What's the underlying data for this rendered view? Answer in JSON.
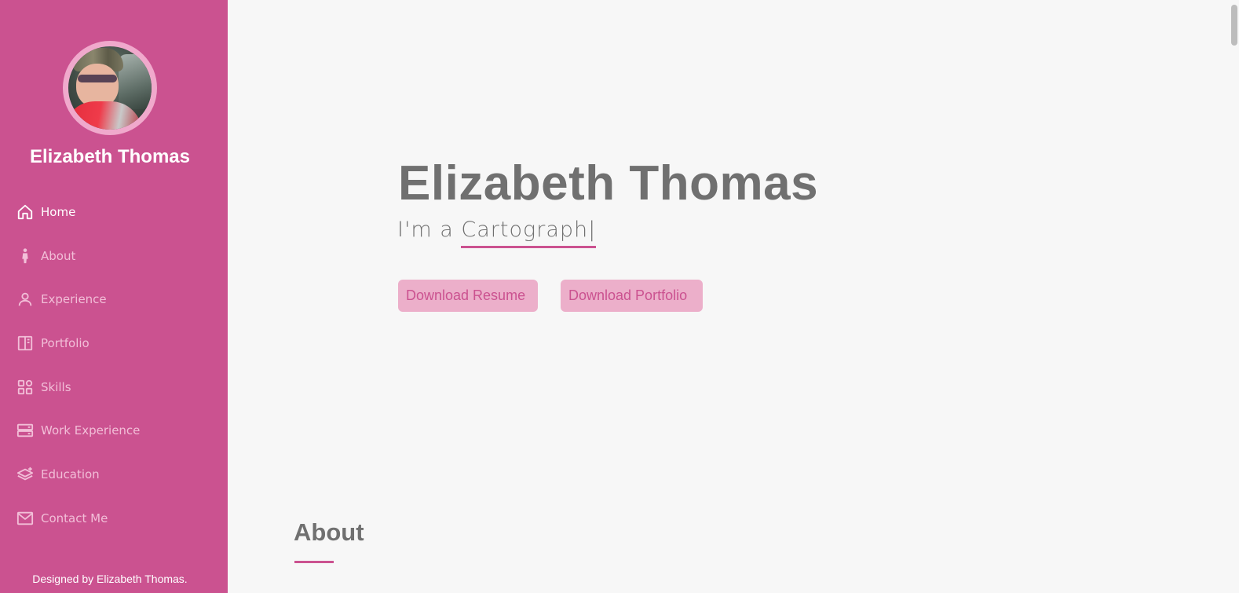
{
  "sidebar": {
    "name": "Elizabeth Thomas",
    "items": [
      {
        "label": "Home",
        "icon": "home-icon"
      },
      {
        "label": "About",
        "icon": "person-icon"
      },
      {
        "label": "Experience",
        "icon": "user-icon"
      },
      {
        "label": "Portfolio",
        "icon": "book-icon"
      },
      {
        "label": "Skills",
        "icon": "grid-icon"
      },
      {
        "label": "Work Experience",
        "icon": "server-icon"
      },
      {
        "label": "Education",
        "icon": "layers-icon"
      },
      {
        "label": "Contact Me",
        "icon": "envelope-icon"
      }
    ],
    "active": "Home",
    "footer": "Designed by Elizabeth Thomas."
  },
  "hero": {
    "name": "Elizabeth Thomas",
    "typed_prefix": "I'm a ",
    "typed_text": "Cartograph",
    "cursor": "|",
    "resume_button": "Download Resume",
    "portfolio_button": "Download Portfolio"
  },
  "about": {
    "title": "About"
  },
  "colors": {
    "sidebar": "#cb5290",
    "accent": "#cb5290",
    "button_bg": "#ecafca",
    "text_gray": "#707070",
    "background": "#f7f7f7"
  }
}
